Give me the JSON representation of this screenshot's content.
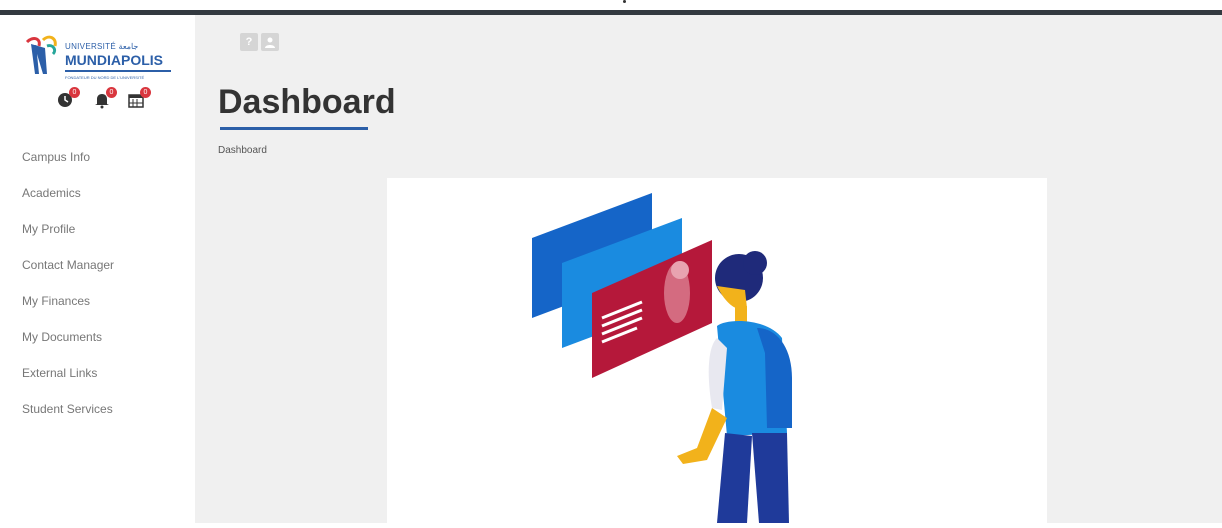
{
  "logo": {
    "top_line": "UNIVERSITÉ",
    "arabic": "جامعة",
    "main": "MUNDIAPOLIS",
    "sub": "FONDATEUR DU NORD DE L'UNIVERSITÉ"
  },
  "notifications": [
    {
      "icon": "clock-icon",
      "count": "0"
    },
    {
      "icon": "bell-icon",
      "count": "0"
    },
    {
      "icon": "calendar-icon",
      "count": "0"
    }
  ],
  "sidebar": {
    "items": [
      {
        "label": "Campus Info"
      },
      {
        "label": "Academics"
      },
      {
        "label": "My Profile"
      },
      {
        "label": "Contact Manager"
      },
      {
        "label": "My Finances"
      },
      {
        "label": "My Documents"
      },
      {
        "label": "External Links"
      },
      {
        "label": "Student Services"
      }
    ]
  },
  "toolbar": {
    "help_label": "?",
    "user_icon": "user-icon"
  },
  "page": {
    "title": "Dashboard",
    "breadcrumb": "Dashboard"
  },
  "colors": {
    "accent": "#2c5fa8",
    "badge": "#d9363e",
    "topbar": "#333a40",
    "illustration_blue": "#1473e6",
    "illustration_red": "#b5183a",
    "illustration_navy": "#1f2a7a",
    "illustration_yellow": "#f2b21b"
  }
}
